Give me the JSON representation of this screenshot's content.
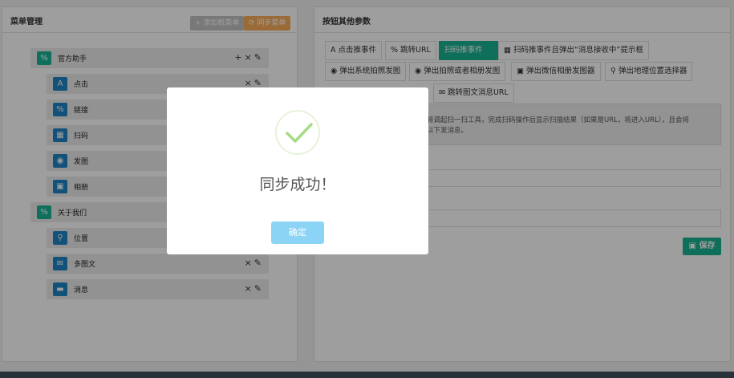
{
  "left_panel": {
    "title": "菜单管理",
    "add_label": "+ 添加根菜单",
    "sync_label": "⟳ 同步菜单",
    "menus": [
      {
        "label": "官方助手",
        "icon": "link-icon",
        "level": 0
      },
      {
        "label": "点击",
        "icon": "font-a-icon",
        "level": 1
      },
      {
        "label": "链接",
        "icon": "link-icon",
        "level": 1
      },
      {
        "label": "扫码",
        "icon": "qrcode-icon",
        "level": 1
      },
      {
        "label": "发图",
        "icon": "camera-icon",
        "level": 1
      },
      {
        "label": "相册",
        "icon": "image-icon",
        "level": 1
      },
      {
        "label": "关于我们",
        "icon": "link-icon",
        "level": 0
      },
      {
        "label": "位置",
        "icon": "map-marker-icon",
        "level": 1
      },
      {
        "label": "多图文",
        "icon": "envelope-icon",
        "level": 1
      },
      {
        "label": "消息",
        "icon": "keyboard-icon",
        "level": 1
      }
    ]
  },
  "right_panel": {
    "title": "按钮其他参数",
    "tabs": [
      {
        "label": "点击推事件",
        "icon": "A"
      },
      {
        "label": "跳转URL",
        "icon": "%"
      },
      {
        "label": "扫码推事件",
        "icon": ""
      },
      {
        "label": "扫码推事件且弹出“消息接收中”提示框",
        "icon": "▦"
      },
      {
        "label": "弹出系统拍照发图",
        "icon": "◉"
      },
      {
        "label": "弹出拍照或者相册发图",
        "icon": "◉"
      },
      {
        "label": "弹出微信相册发图器",
        "icon": "▣"
      },
      {
        "label": "弹出地理位置选择器",
        "icon": "⚲"
      },
      {
        "label": "跳转图文消息URL",
        "icon": "✉"
      }
    ],
    "description_line1": "将调起扫一扫工具，完成扫码操作后显示扫描结果（如果是URL，将进入URL），且会将",
    "description_line2": "以下发消息。",
    "save_label": "保存"
  },
  "dialog": {
    "title": "同步成功！",
    "ok_label": "确定"
  },
  "colors": {
    "primary": "#1ab394",
    "blue": "#1c84c6",
    "warning": "#f8ac59",
    "confirm": "#8cd4f5"
  }
}
